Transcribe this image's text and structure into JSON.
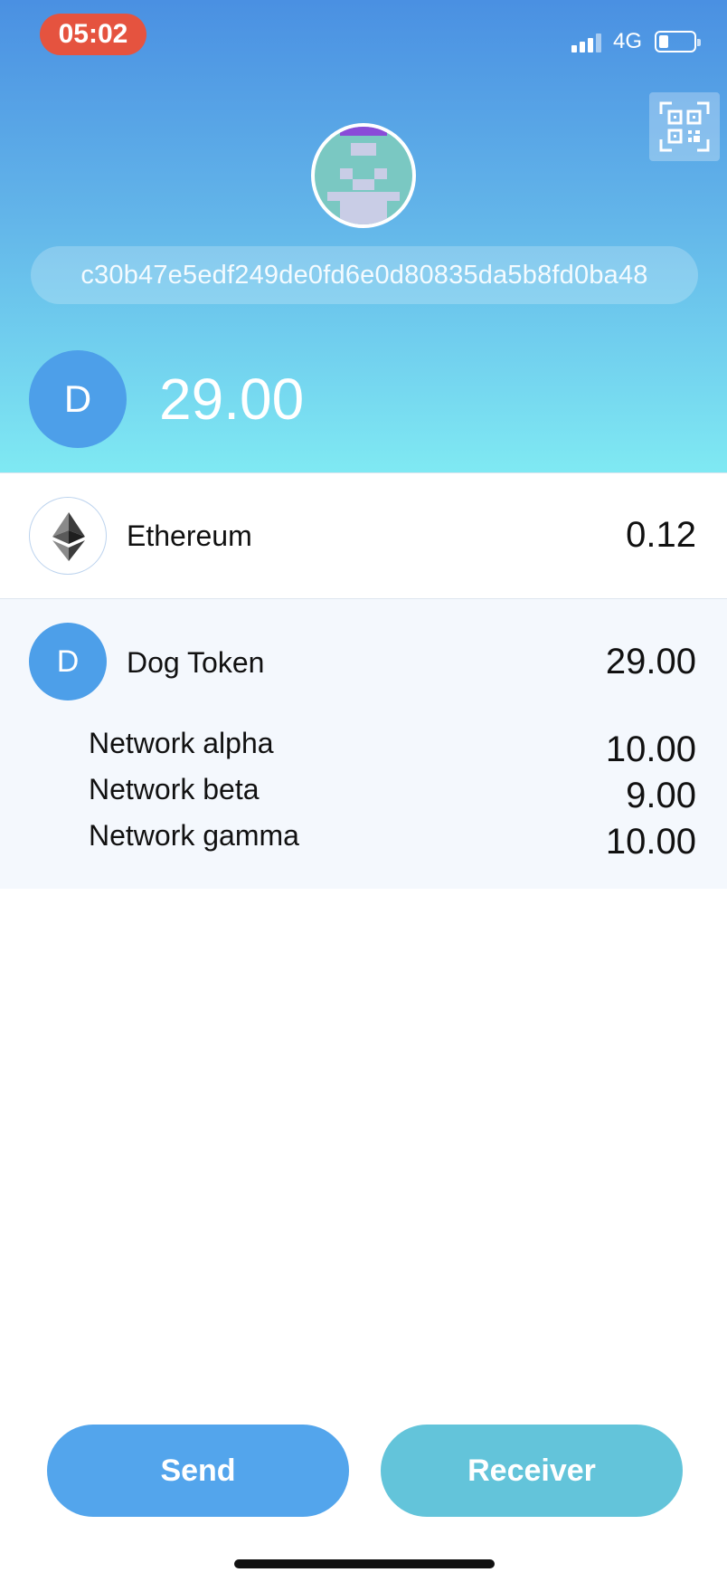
{
  "status_bar": {
    "time": "05:02",
    "network": "4G",
    "battery_level": 0.2,
    "signal_bars": 3
  },
  "header": {
    "qr_icon": "qr-code-icon",
    "avatar_icon": "pixel-avatar",
    "address": "c30b47e5edf249de0fd6e0d80835da5b8fd0ba48",
    "selected_token_letter": "D",
    "selected_token_balance": "29.00"
  },
  "tokens": {
    "ethereum": {
      "icon": "ethereum-icon",
      "name": "Ethereum",
      "value": "0.12"
    },
    "dog": {
      "letter": "D",
      "name": "Dog Token",
      "value": "29.00",
      "networks": [
        {
          "name": "Network alpha",
          "value": "10.00"
        },
        {
          "name": "Network beta",
          "value": "9.00"
        },
        {
          "name": "Network gamma",
          "value": "10.00"
        }
      ]
    }
  },
  "actions": {
    "send_label": "Send",
    "receive_label": "Receiver"
  },
  "colors": {
    "accent_blue": "#53a5ec",
    "accent_teal": "#63c4da",
    "time_pill": "#e5533f"
  }
}
